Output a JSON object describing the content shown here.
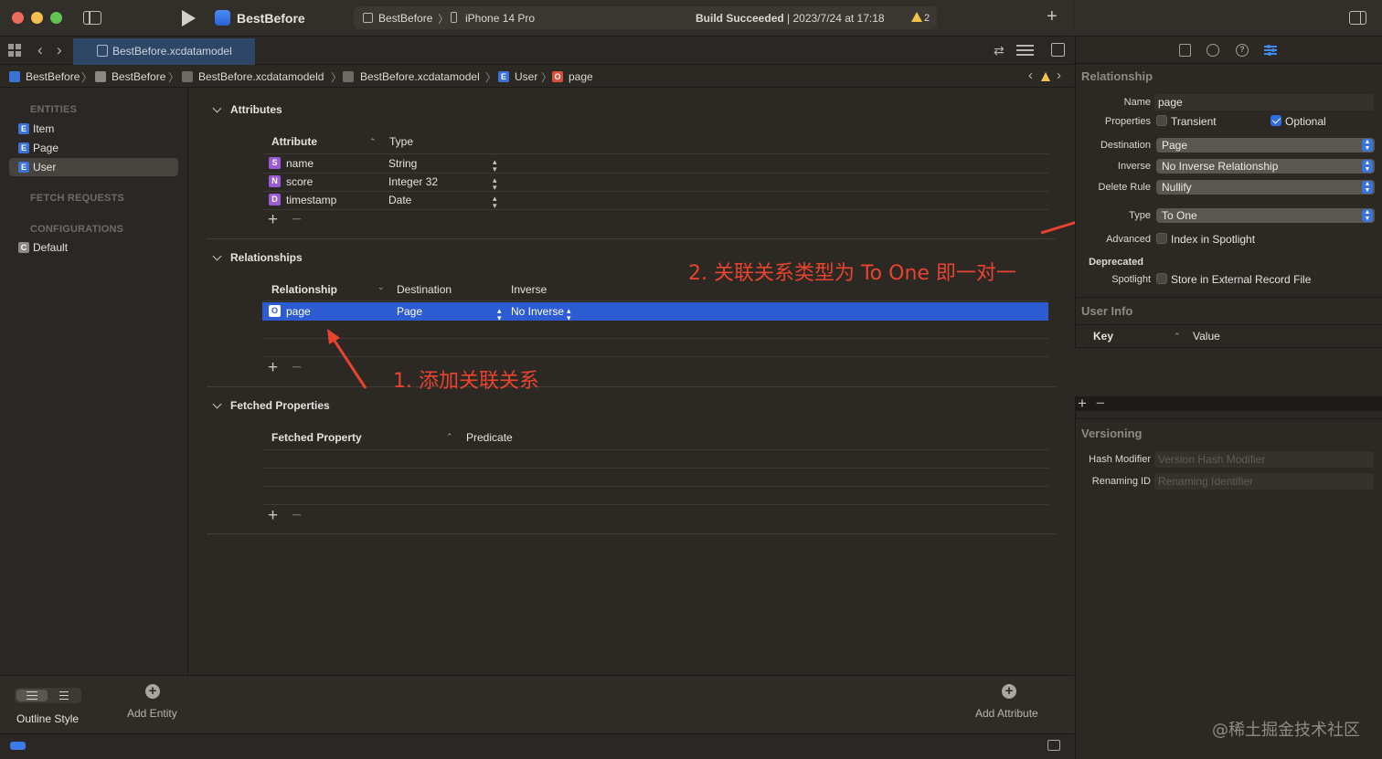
{
  "app": {
    "name": "BestBefore",
    "scheme": "BestBefore",
    "device": "iPhone 14 Pro",
    "build_status_bold": "Build Succeeded",
    "build_status_rest": " | 2023/7/24 at 17:18",
    "warning_count": "2"
  },
  "tab": {
    "label": "BestBefore.xcdatamodel"
  },
  "breadcrumb": {
    "items": [
      "BestBefore",
      "BestBefore",
      "BestBefore.xcdatamodeld",
      "BestBefore.xcdatamodel",
      "User",
      "page"
    ],
    "sep": "〉"
  },
  "sidebar": {
    "entities_header": "ENTITIES",
    "entities": [
      {
        "badge": "E",
        "label": "Item"
      },
      {
        "badge": "E",
        "label": "Page"
      },
      {
        "badge": "E",
        "label": "User"
      }
    ],
    "fetch_header": "FETCH REQUESTS",
    "config_header": "CONFIGURATIONS",
    "configs": [
      {
        "badge": "C",
        "label": "Default"
      }
    ]
  },
  "attributes": {
    "title": "Attributes",
    "col_attribute": "Attribute",
    "col_type": "Type",
    "rows": [
      {
        "badge": "S",
        "name": "name",
        "type": "String"
      },
      {
        "badge": "N",
        "name": "score",
        "type": "Integer 32"
      },
      {
        "badge": "D",
        "name": "timestamp",
        "type": "Date"
      }
    ]
  },
  "relationships": {
    "title": "Relationships",
    "col_relationship": "Relationship",
    "col_destination": "Destination",
    "col_inverse": "Inverse",
    "rows": [
      {
        "badge": "O",
        "name": "page",
        "destination": "Page",
        "inverse": "No Inverse"
      }
    ]
  },
  "fetched": {
    "title": "Fetched Properties",
    "col_property": "Fetched Property",
    "col_predicate": "Predicate"
  },
  "annotations": {
    "step1": "1. 添加关联关系",
    "step2": "2. 关联关系类型为 To One 即一对一"
  },
  "bottom": {
    "outline_style": "Outline Style",
    "add_entity": "Add Entity",
    "add_attribute": "Add Attribute"
  },
  "inspector": {
    "relationship_header": "Relationship",
    "name_label": "Name",
    "name_value": "page",
    "properties_label": "Properties",
    "transient_label": "Transient",
    "optional_label": "Optional",
    "transient_checked": false,
    "optional_checked": true,
    "destination_label": "Destination",
    "destination_value": "Page",
    "inverse_label": "Inverse",
    "inverse_value": "No Inverse Relationship",
    "delete_rule_label": "Delete Rule",
    "delete_rule_value": "Nullify",
    "type_label": "Type",
    "type_value": "To One",
    "advanced_label": "Advanced",
    "index_spotlight_label": "Index in Spotlight",
    "deprecated_label": "Deprecated",
    "spotlight_label": "Spotlight",
    "store_external_label": "Store in External Record File",
    "user_info_header": "User Info",
    "key_col": "Key",
    "value_col": "Value",
    "versioning_header": "Versioning",
    "hash_modifier_label": "Hash Modifier",
    "hash_modifier_placeholder": "Version Hash Modifier",
    "renaming_id_label": "Renaming ID",
    "renaming_id_placeholder": "Renaming Identifier"
  },
  "watermark": "@稀土掘金技术社区",
  "colors": {
    "accent": "#2d5bd2",
    "annotation": "#e8432e",
    "entity_badge": "#3c72d6",
    "relationship_badge": "#d9503c",
    "string_badge": "#9b5bd4"
  }
}
